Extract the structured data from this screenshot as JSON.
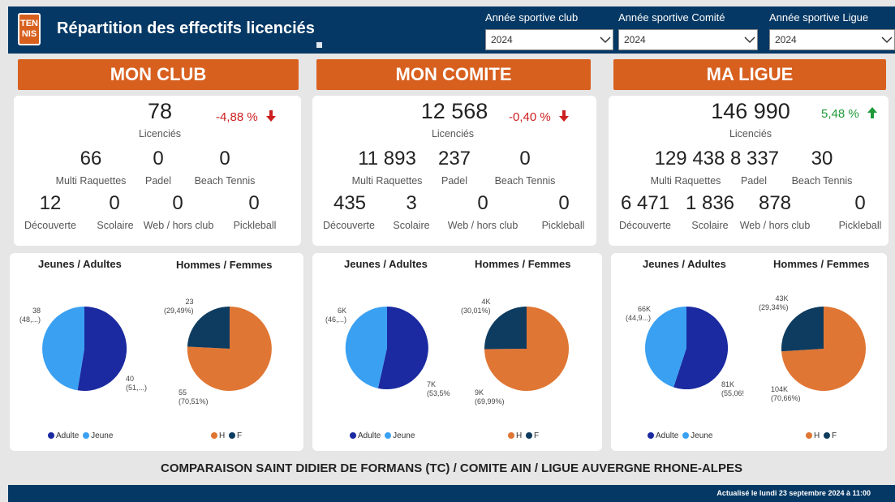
{
  "header": {
    "logo": {
      "line1": "TEN",
      "line2": "NIS"
    },
    "title": "Répartition des effectifs licenciés",
    "filters": [
      {
        "label": "Année sportive club",
        "value": "2024"
      },
      {
        "label": "Année sportive Comité",
        "value": "2024"
      },
      {
        "label": "Année sportive Ligue",
        "value": "2024"
      }
    ]
  },
  "panels": [
    {
      "banner": "MON CLUB",
      "total": "78",
      "total_label": "Licenciés",
      "change": "-4,88 %",
      "trend": "down",
      "row1": [
        {
          "value": "66",
          "label": "Multi Raquettes"
        },
        {
          "value": "0",
          "label": "Padel"
        },
        {
          "value": "0",
          "label": "Beach Tennis"
        }
      ],
      "row2": [
        {
          "value": "12",
          "label": "Découverte"
        },
        {
          "value": "0",
          "label": "Scolaire"
        },
        {
          "value": "0",
          "label": "Web / hors club"
        },
        {
          "value": "0",
          "label": "Pickleball"
        }
      ],
      "age_chart": {
        "title": "Jeunes / Adultes",
        "label_jeune": "38",
        "label_jeune_pct": "(48,...)",
        "label_adulte": "40",
        "label_adulte_pct": "(51,...)"
      },
      "sex_chart": {
        "title": "Hommes / Femmes",
        "label_f": "23",
        "label_f_pct": "(29,49%)",
        "label_h": "55",
        "label_h_pct": "(70,51%)"
      }
    },
    {
      "banner": "MON COMITE",
      "total": "12 568",
      "total_label": "Licenciés",
      "change": "-0,40 %",
      "trend": "down",
      "row1": [
        {
          "value": "11 893",
          "label": "Multi Raquettes"
        },
        {
          "value": "237",
          "label": "Padel"
        },
        {
          "value": "0",
          "label": "Beach Tennis"
        }
      ],
      "row2": [
        {
          "value": "435",
          "label": "Découverte"
        },
        {
          "value": "3",
          "label": "Scolaire"
        },
        {
          "value": "0",
          "label": "Web / hors club"
        },
        {
          "value": "0",
          "label": "Pickleball"
        }
      ],
      "age_chart": {
        "title": "Jeunes / Adultes",
        "label_jeune": "6K",
        "label_jeune_pct": "(46,...)",
        "label_adulte": "7K",
        "label_adulte_pct": "(53,5%"
      },
      "sex_chart": {
        "title": "Hommes / Femmes",
        "label_f": "4K",
        "label_f_pct": "(30,01%)",
        "label_h": "9K",
        "label_h_pct": "(69,99%)"
      }
    },
    {
      "banner": "MA LIGUE",
      "total": "146 990",
      "total_label": "Licenciés",
      "change": "5,48 %",
      "trend": "up",
      "row1": [
        {
          "value": "129 438",
          "label": "Multi Raquettes"
        },
        {
          "value": "8 337",
          "label": "Padel"
        },
        {
          "value": "30",
          "label": "Beach Tennis"
        }
      ],
      "row2": [
        {
          "value": "6 471",
          "label": "Découverte"
        },
        {
          "value": "1 836",
          "label": "Scolaire"
        },
        {
          "value": "878",
          "label": "Web / hors club"
        },
        {
          "value": "0",
          "label": "Pickleball"
        }
      ],
      "age_chart": {
        "title": "Jeunes / Adultes",
        "label_jeune": "66K",
        "label_jeune_pct": "(44,9...)",
        "label_adulte": "81K",
        "label_adulte_pct": "(55,06!"
      },
      "sex_chart": {
        "title": "Hommes / Femmes",
        "label_f": "43K",
        "label_f_pct": "(29,34%)",
        "label_h": "104K",
        "label_h_pct": "(70,66%)"
      }
    }
  ],
  "legend": {
    "adulte": "Adulte",
    "jeune": "Jeune",
    "h": "H",
    "f": "F"
  },
  "colors": {
    "header_bg": "#053864",
    "accent_orange": "#d8601f",
    "adulte": "#1b2aa0",
    "jeune": "#3aa0f2",
    "homme": "#e07634",
    "femme": "#0e3c60",
    "negative": "#cc2020",
    "positive": "#1f9a3a"
  },
  "chart_data": [
    {
      "type": "pie",
      "title": "Jeunes / Adultes",
      "labels": [
        "Adulte",
        "Jeune"
      ],
      "values": [
        40,
        38
      ]
    },
    {
      "type": "pie",
      "title": "Hommes / Femmes",
      "labels": [
        "H",
        "F"
      ],
      "values": [
        55,
        23
      ]
    },
    {
      "type": "pie",
      "title": "Jeunes / Adultes",
      "labels": [
        "Adulte",
        "Jeune"
      ],
      "values": [
        53.5,
        46.5
      ]
    },
    {
      "type": "pie",
      "title": "Hommes / Femmes",
      "labels": [
        "H",
        "F"
      ],
      "values": [
        69.99,
        30.01
      ]
    },
    {
      "type": "pie",
      "title": "Jeunes / Adultes",
      "labels": [
        "Adulte",
        "Jeune"
      ],
      "values": [
        55.06,
        44.94
      ]
    },
    {
      "type": "pie",
      "title": "Hommes / Femmes",
      "labels": [
        "H",
        "F"
      ],
      "values": [
        70.66,
        29.34
      ]
    }
  ],
  "footer": {
    "comparison": "COMPARAISON SAINT DIDIER DE FORMANS (TC) / COMITE AIN / LIGUE AUVERGNE RHONE-ALPES",
    "updated": "Actualisé le lundi 23 septembre 2024 à 11:00"
  }
}
